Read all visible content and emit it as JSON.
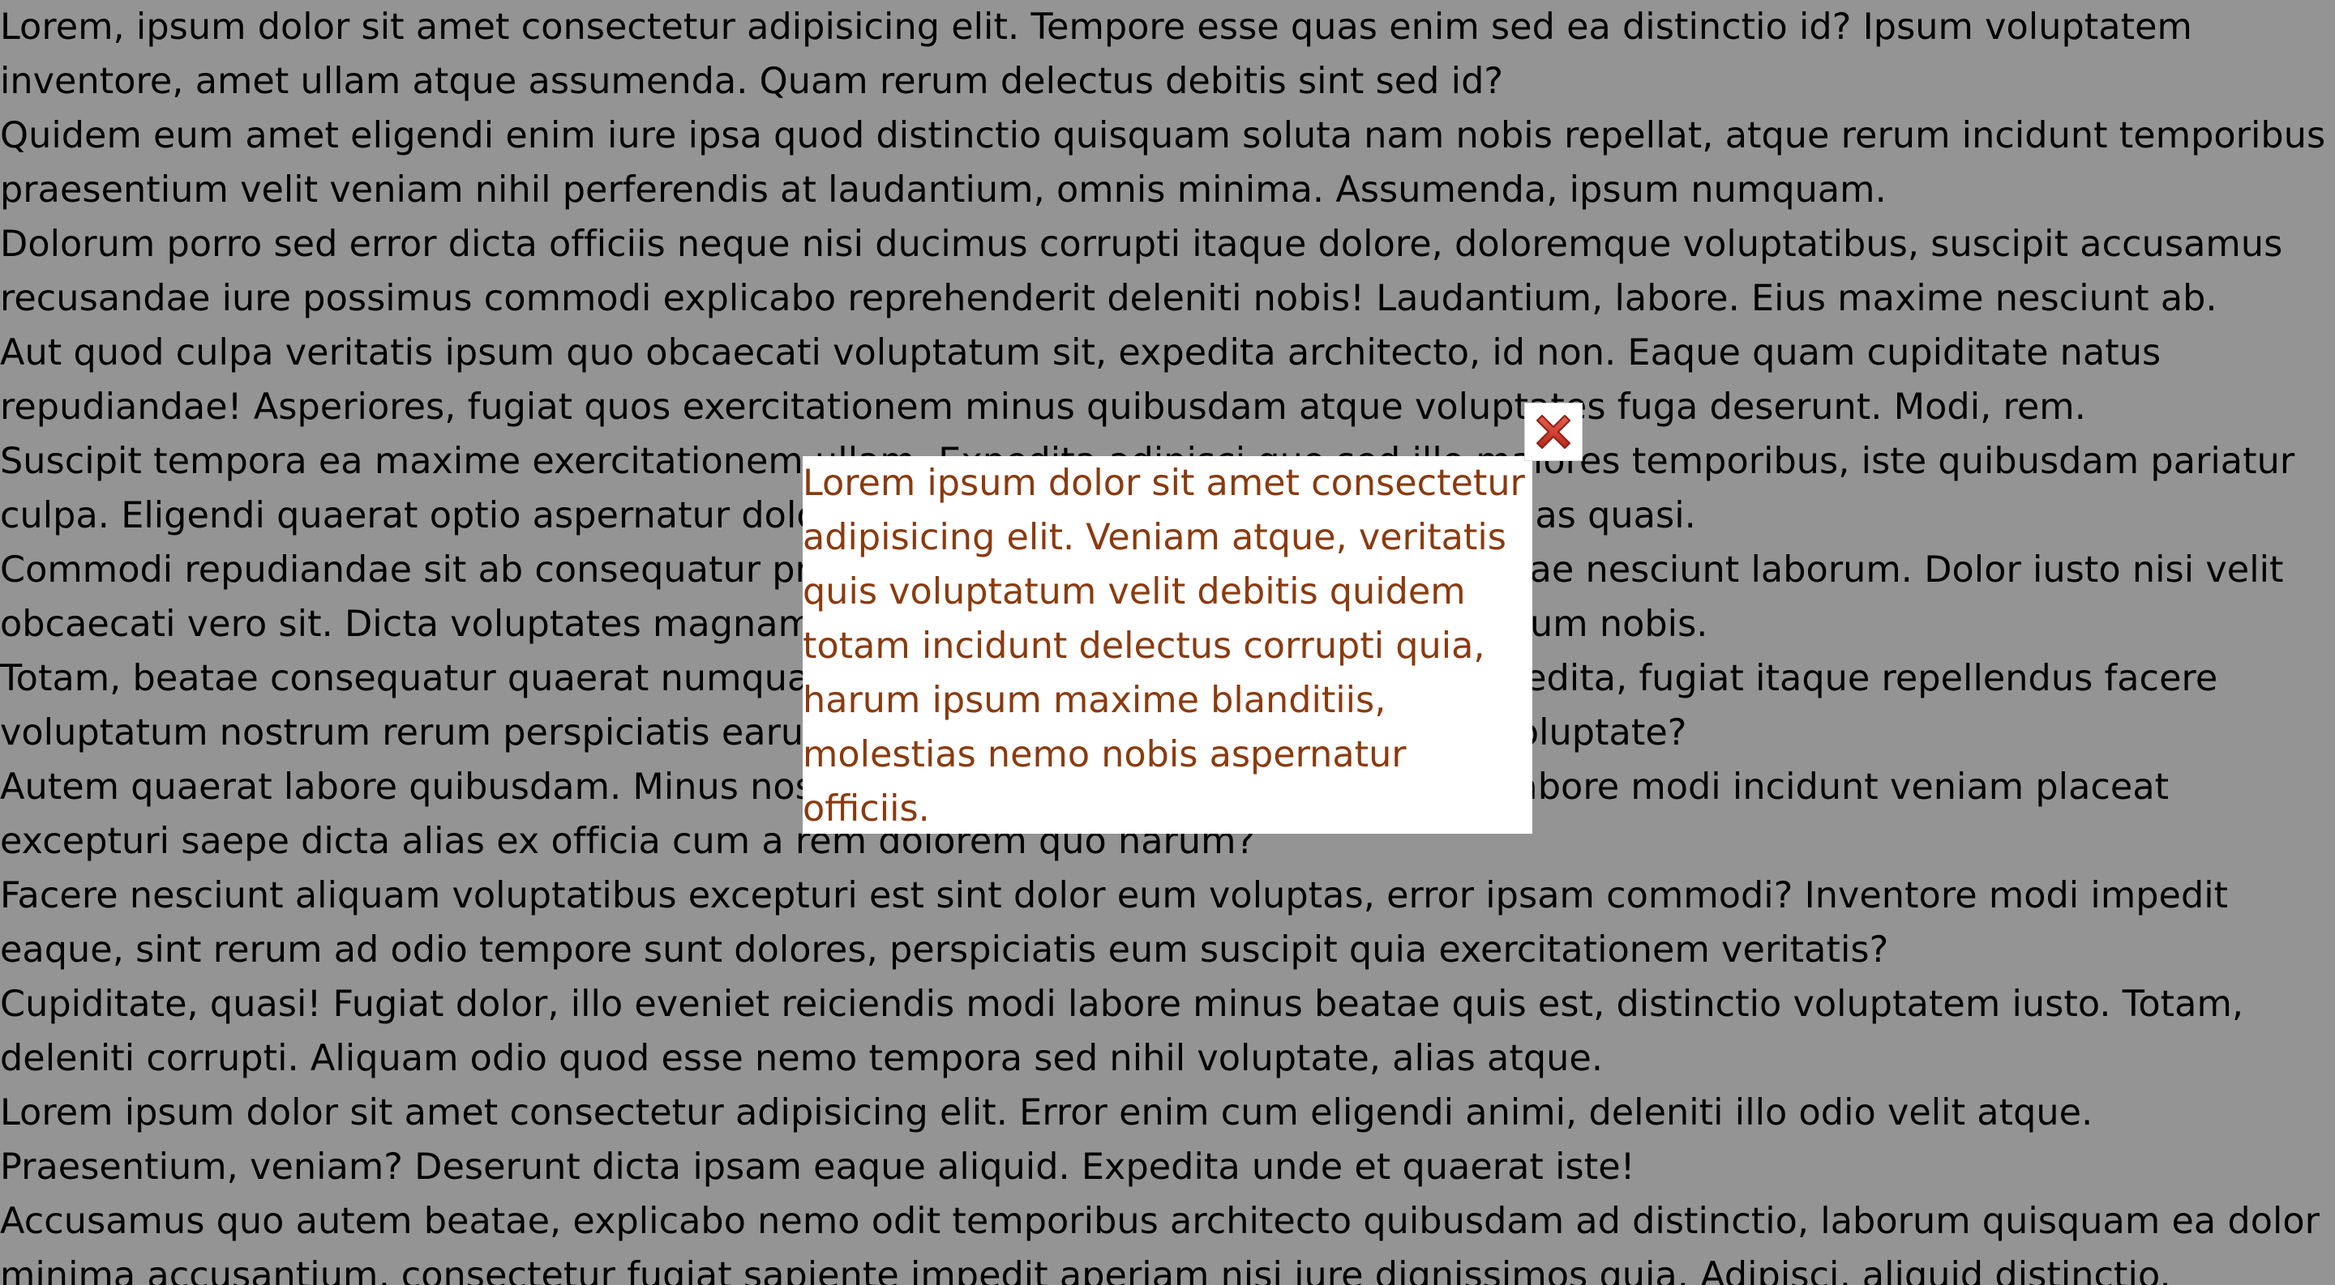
{
  "background": {
    "paragraphs": [
      "Lorem, ipsum dolor sit amet consectetur adipisicing elit. Tempore esse quas enim sed ea distinctio id? Ipsum voluptatem inventore, amet ullam atque assumenda. Quam rerum delectus debitis sint sed id?",
      "Quidem eum amet eligendi enim iure ipsa quod distinctio quisquam soluta nam nobis repellat, atque rerum incidunt temporibus praesentium velit veniam nihil perferendis at laudantium, omnis minima. Assumenda, ipsum numquam.",
      "Dolorum porro sed error dicta officiis neque nisi ducimus corrupti itaque dolore, doloremque voluptatibus, suscipit accusamus recusandae iure possimus commodi explicabo reprehenderit deleniti nobis! Laudantium, labore. Eius maxime nesciunt ab.",
      "Aut quod culpa veritatis ipsum quo obcaecati voluptatum sit, expedita architecto, id non. Eaque quam cupiditate natus repudiandae! Asperiores, fugiat quos exercitationem minus quibusdam atque voluptates fuga deserunt. Modi, rem.",
      "Suscipit tempora ea maxime exercitationem ullam. Expedita adipisci quo sed illo maiores temporibus, iste quibusdam pariatur culpa. Eligendi quaerat optio aspernatur dolorem ipsam aut deserunt vero ipsam, quas quasi.",
      "Commodi repudiandae sit ab consequatur provident nobis quos esse ratione molestiae nesciunt laborum. Dolor iusto nisi velit obcaecati vero sit. Dicta voluptates magnam eos recusandae. Praesentium, laudantium nobis.",
      "Totam, beatae consequatur quaerat numquam nemo, totam asperiores cumque expedita, fugiat itaque repellendus facere voluptatum nostrum rerum perspiciatis earum iure ipsum quas. Blanditiis, dolores voluptate?",
      "Autem quaerat labore quibusdam. Minus nostrum ad odio voluptatum quam, enim labore modi incidunt veniam placeat excepturi saepe dicta alias ex officia cum a rem dolorem quo harum?",
      "Facere nesciunt aliquam voluptatibus excepturi est sint dolor eum voluptas, error ipsam commodi? Inventore modi impedit eaque, sint rerum ad odio tempore sunt dolores, perspiciatis eum suscipit quia exercitationem veritatis?",
      "Cupiditate, quasi! Fugiat dolor, illo eveniet reiciendis modi labore minus beatae quis est, distinctio voluptatem iusto. Totam, deleniti corrupti. Aliquam odio quod esse nemo tempora sed nihil voluptate, alias atque.",
      "Lorem ipsum dolor sit amet consectetur adipisicing elit. Error enim cum eligendi animi, deleniti illo odio velit atque. Praesentium, veniam? Deserunt dicta ipsam eaque aliquid. Expedita unde et quaerat iste!",
      "Accusamus quo autem beatae, explicabo nemo odit temporibus architecto quibusdam ad distinctio, laborum quisquam ea dolor minima accusantium, consectetur fugiat sapiente impedit aperiam nisi iure dignissimos quia. Adipisci, aliquid distinctio."
    ]
  },
  "modal": {
    "text": "Lorem ipsum dolor sit amet consectetur adipisicing elit. Veniam atque, veritatis quis voluptatum velit debitis quidem totam incidunt delectus corrupti quia, harum ipsum maxime blanditiis, molestias nemo nobis aspernatur officiis.",
    "text_color": "#8b3a0e",
    "close_icon": "close-icon",
    "close_icon_color": "#c0392b"
  },
  "overlay": {
    "color": "#000000",
    "opacity": 0.42
  }
}
